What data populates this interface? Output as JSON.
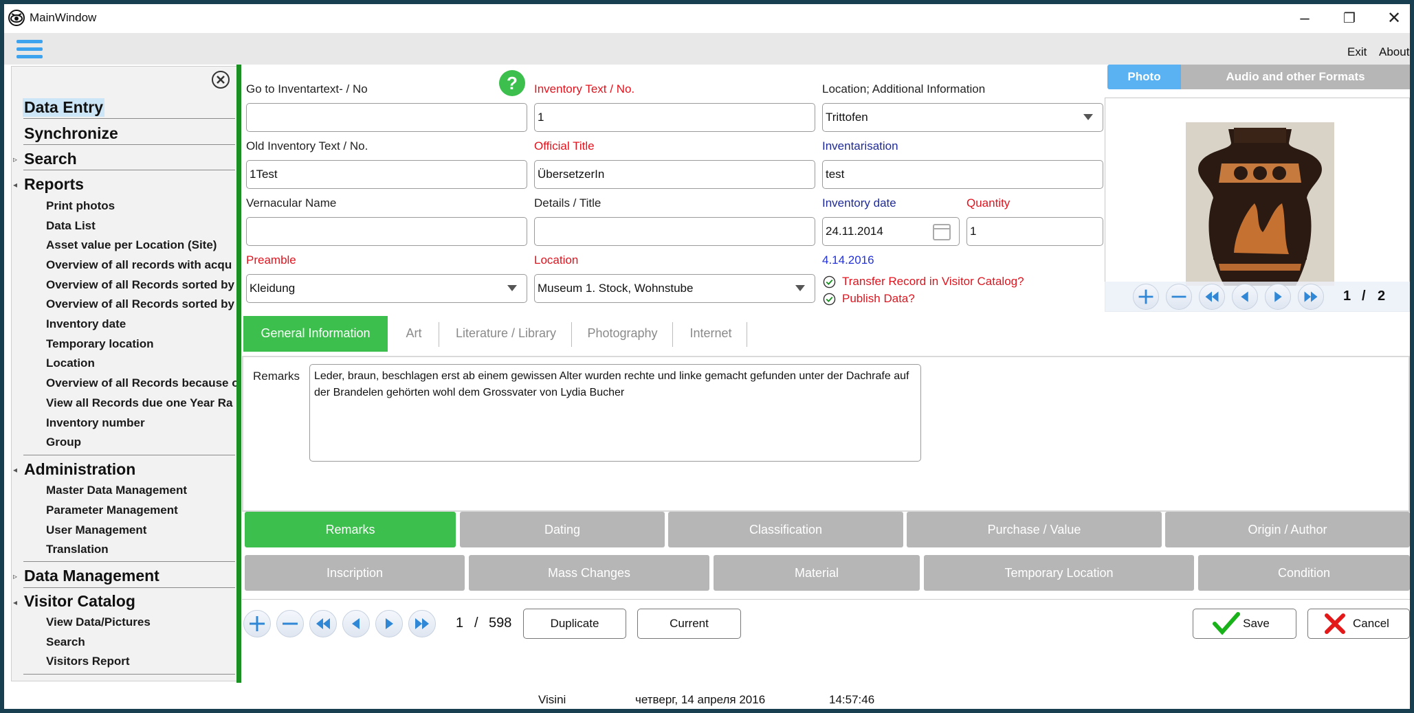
{
  "window": {
    "title": "MainWindow",
    "min": "–",
    "restore": "❐",
    "close": "✕"
  },
  "menu": {
    "exit": "Exit",
    "about": "About"
  },
  "sidebar": {
    "data_entry": "Data Entry",
    "synchronize": "Synchronize",
    "search": "Search",
    "reports": "Reports",
    "report_items": [
      "Print photos",
      "Data List",
      "Asset value per Location (Site)",
      "Overview of all records with acqu",
      "Overview of all Records sorted by",
      "Overview of all Records sorted by",
      "Inventory date",
      "Temporary location",
      "Location",
      "Overview of all Records because o",
      "View all Records due one Year Ra",
      "Inventory number",
      "Group"
    ],
    "administration": "Administration",
    "admin_items": [
      "Master Data Management",
      "Parameter Management",
      "User Management",
      "Translation"
    ],
    "data_management": "Data Management",
    "visitor_catalog": "Visitor Catalog",
    "visitor_items": [
      "View Data/Pictures",
      "Search",
      "Visitors Report"
    ]
  },
  "form": {
    "goto_label": "Go to Inventartext- / No",
    "goto_value": "",
    "inv_text_label": "Inventory Text / No.",
    "inv_text_value": "1",
    "location_add_label": "Location; Additional Information",
    "location_add_value": "Trittofen",
    "old_inv_label": "Old Inventory Text / No.",
    "old_inv_value": "1Test",
    "official_title_label": "Official Title",
    "official_title_value": "ÜbersetzerIn",
    "inventarisation_label": "Inventarisation",
    "inventarisation_value": "test",
    "vernacular_label": "Vernacular Name",
    "vernacular_value": "",
    "details_label": "Details / Title",
    "details_value": "",
    "inv_date_label": "Inventory date",
    "inv_date_value": "24.11.2014",
    "quantity_label": "Quantity",
    "quantity_value": "1",
    "preamble_label": "Preamble",
    "preamble_value": "Kleidung",
    "location_label": "Location",
    "location_value": "Museum 1. Stock, Wohnstube",
    "date_link": "4.14.2016",
    "transfer_check": "Transfer Record in Visitor Catalog?",
    "publish_check": "Publish Data?",
    "help": "?"
  },
  "tabs": [
    "General Information",
    "Art",
    "Literature / Library",
    "Photography",
    "Internet"
  ],
  "remarks": {
    "label": "Remarks",
    "text": "Leder, braun, beschlagen erst ab einem gewissen Alter wurden rechte und linke gemacht gefunden unter der Dachrafe auf der Brandelen gehörten wohl dem Grossvater von Lydia Bucher"
  },
  "section_buttons_row1": [
    "Remarks",
    "Dating",
    "Classification",
    "Purchase / Value",
    "Origin / Author"
  ],
  "section_buttons_row2": [
    "Inscription",
    "Mass Changes",
    "Material",
    "Temporary Location",
    "Condition"
  ],
  "record_nav": {
    "current": "1",
    "sep": "/",
    "total": "598",
    "duplicate": "Duplicate",
    "current_btn": "Current",
    "save": "Save",
    "cancel": "Cancel"
  },
  "photo": {
    "tab_photo": "Photo",
    "tab_audio": "Audio and other Formats",
    "current": "1",
    "sep": "/",
    "total": "2"
  },
  "status": {
    "user": "Visini",
    "date": "четверг, 14 апреля 2016",
    "time": "14:57:46"
  },
  "colors": {
    "accent_green": "#3dbf4e",
    "sidebar_green": "#1a8f22",
    "accent_blue": "#3ea3ee",
    "required_red": "#e0141e"
  }
}
